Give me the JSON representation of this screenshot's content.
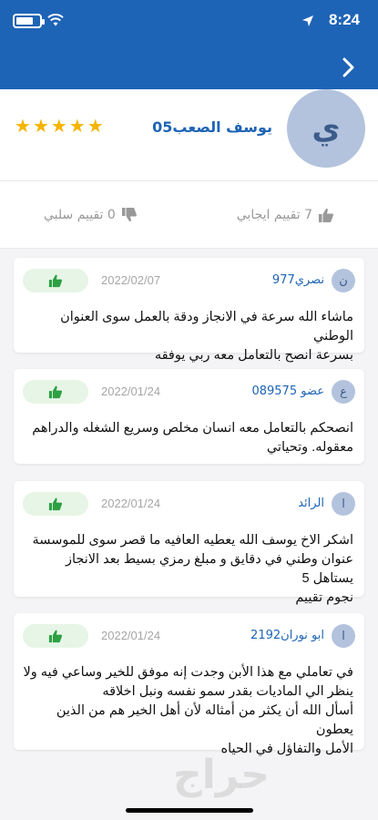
{
  "status": {
    "time": "8:24"
  },
  "profile": {
    "avatar_letter": "ي",
    "name": "يوسف الصعب05",
    "stars": "★★★★★"
  },
  "summary": {
    "positive": "7 تقييم ايجابي",
    "negative": "0 تقييم سلبي"
  },
  "reviews": [
    {
      "avatar": "ن",
      "name": "نصري977",
      "date": "2022/02/07",
      "text": "ماشاء الله سرعة في الانجاز ودقة بالعمل سوى العنوان الوطني\nبسرعة انصح بالتعامل معه ربي يوفقه"
    },
    {
      "avatar": "ع",
      "name": "عضو 089575",
      "date": "2022/01/24",
      "text": "انصحكم بالتعامل معه انسان مخلص وسريع الشغله والدراهم\nمعقوله.              وتحياتي"
    },
    {
      "avatar": "ا",
      "name": "الرائد",
      "date": "2022/01/24",
      "text": "اشكر الاخ يوسف الله يعطيه العافيه ما قصر سوى للموسسة\nعنوان وطني في دقايق و مبلغ رمزي بسيط بعد الانجاز يستاهل 5\nنجوم تقييم"
    },
    {
      "avatar": "ا",
      "name": "ابو نوران2192",
      "date": "2022/01/24",
      "text": "في تعاملي مع هذا الأبن وجدت إنه موفق للخير وساعي فيه ولا\nينظر الي الماديات بقدر سمو نفسه ونبل اخلاقه\nأسأل الله أن يكثر من أمثاله لأن أهل الخير هم من الذين يعطون\nالأمل والتفاؤل في الحياه"
    }
  ],
  "watermark": "حراج",
  "colors": {
    "header": "#1e64b6",
    "star": "#f5b400",
    "like_bg": "#e6f5e6",
    "like_icon": "#2ea043"
  }
}
